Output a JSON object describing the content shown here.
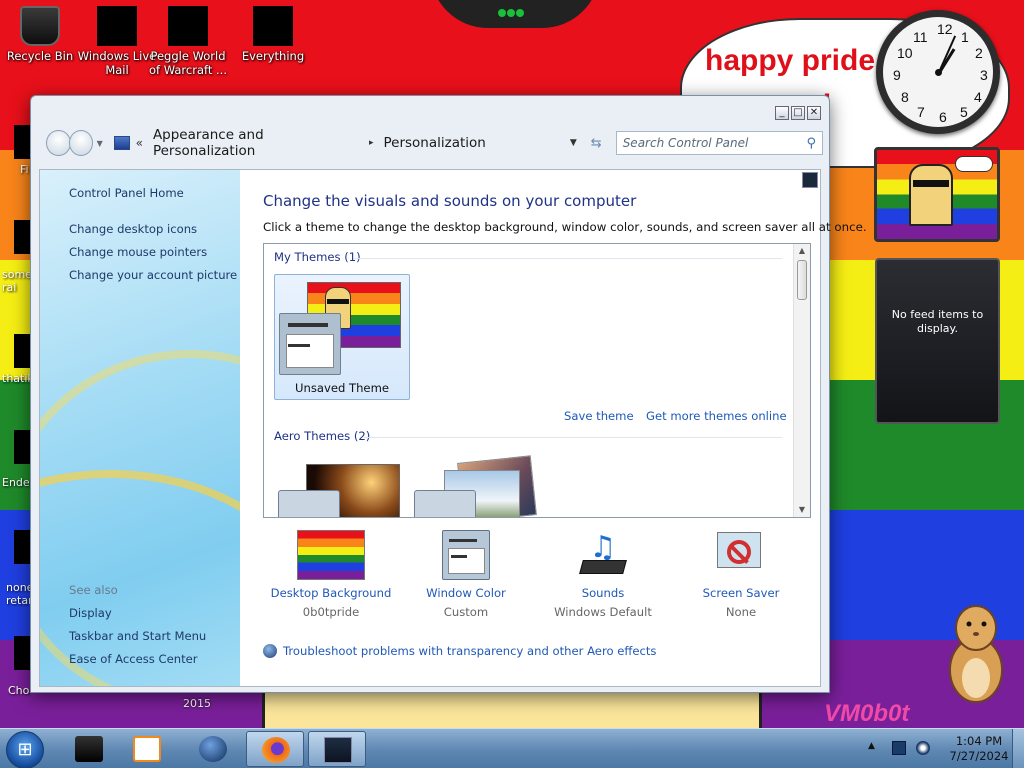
{
  "desktop": {
    "icons": [
      {
        "label": "Recycle Bin",
        "icon": "recycle-bin-icon"
      },
      {
        "label": "Windows Live Mail",
        "icon": "mail-icon"
      },
      {
        "label": "Peggle World of Warcraft ...",
        "icon": "game-icon"
      },
      {
        "label": "Everything",
        "icon": "search-icon"
      }
    ],
    "left_partial_labels": [
      "Fi",
      "some\nrai",
      "thatik",
      "Ende",
      "none\nretar",
      "Cho"
    ],
    "wallpaper": {
      "banner_line1": "happy pride m",
      "banner_line2": "!",
      "watermark_year": "2015",
      "signature": "VM0b0t",
      "colors": [
        "#e8101a",
        "#f8841a",
        "#f5ee14",
        "#1f8a2a",
        "#1f3fe0",
        "#7a1f9a"
      ]
    }
  },
  "gadgets": {
    "clock": {
      "time": "1:04"
    },
    "feed": {
      "message": "No feed items to display."
    }
  },
  "window": {
    "breadcrumb": [
      "Appearance and Personalization",
      "Personalization"
    ],
    "search_placeholder": "Search Control Panel",
    "caption_buttons": {
      "minimize": "_",
      "maximize": "□",
      "close": "✕"
    },
    "sidebar": {
      "home": "Control Panel Home",
      "tasks": [
        "Change desktop icons",
        "Change mouse pointers",
        "Change your account picture"
      ],
      "see_also_heading": "See also",
      "see_also": [
        "Display",
        "Taskbar and Start Menu",
        "Ease of Access Center"
      ]
    },
    "main": {
      "title": "Change the visuals and sounds on your computer",
      "subtitle": "Click a theme to change the desktop background, window color, sounds, and screen saver all at once.",
      "my_themes_heading": "My Themes (1)",
      "unsaved_theme_label": "Unsaved Theme",
      "save_theme": "Save theme",
      "get_more_themes": "Get more themes online",
      "aero_themes_heading": "Aero Themes (2)",
      "bottom_items": [
        {
          "name": "Desktop Background",
          "value": "0b0tpride",
          "icon": "desktop-background-icon"
        },
        {
          "name": "Window Color",
          "value": "Custom",
          "icon": "window-color-icon"
        },
        {
          "name": "Sounds",
          "value": "Windows Default",
          "icon": "sounds-icon"
        },
        {
          "name": "Screen Saver",
          "value": "None",
          "icon": "screen-saver-icon"
        }
      ],
      "troubleshoot": "Troubleshoot problems with transparency and other Aero effects"
    }
  },
  "taskbar": {
    "time": "1:04 PM",
    "date": "7/27/2024",
    "pinned": [
      "explorer-icon",
      "media-player-icon",
      "globe-icon",
      "firefox-icon",
      "control-panel-icon"
    ]
  }
}
